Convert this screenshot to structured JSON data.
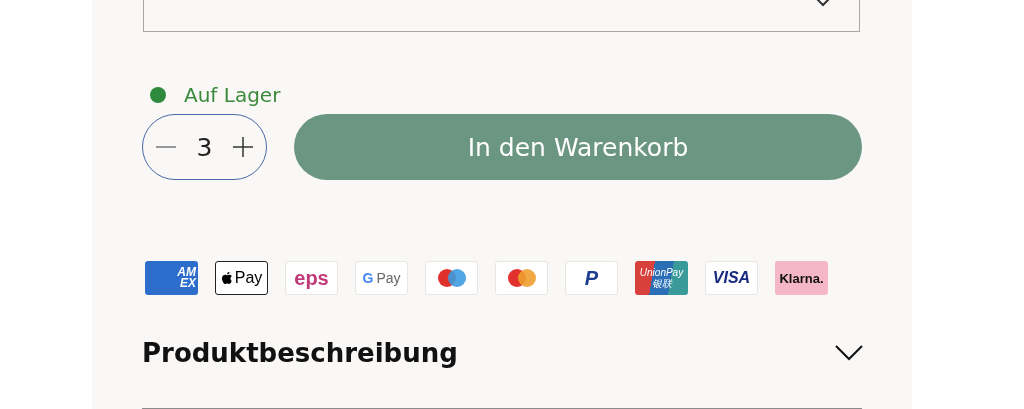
{
  "select": {
    "kind": "dropdown"
  },
  "stock": {
    "in_stock": true,
    "label": "Auf Lager"
  },
  "quantity": {
    "value": "3"
  },
  "add_to_cart": {
    "label": "In den Warenkorb"
  },
  "payment_methods": [
    {
      "kind": "amex",
      "texts": [
        "AM",
        "EX"
      ]
    },
    {
      "kind": "applepay",
      "texts": [
        "Pay"
      ]
    },
    {
      "kind": "eps",
      "texts": [
        "eps"
      ]
    },
    {
      "kind": "gpay",
      "texts": [
        "G",
        "Pay"
      ]
    },
    {
      "kind": "maestro"
    },
    {
      "kind": "mastercard"
    },
    {
      "kind": "paypal",
      "texts": [
        "P"
      ]
    },
    {
      "kind": "unionpay",
      "texts": [
        "UnionPay",
        "银联"
      ]
    },
    {
      "kind": "visa",
      "texts": [
        "VISA"
      ]
    },
    {
      "kind": "klarna",
      "texts": [
        "Klarna."
      ]
    }
  ],
  "description": {
    "title": "Produktbeschreibung",
    "expanded": false
  }
}
